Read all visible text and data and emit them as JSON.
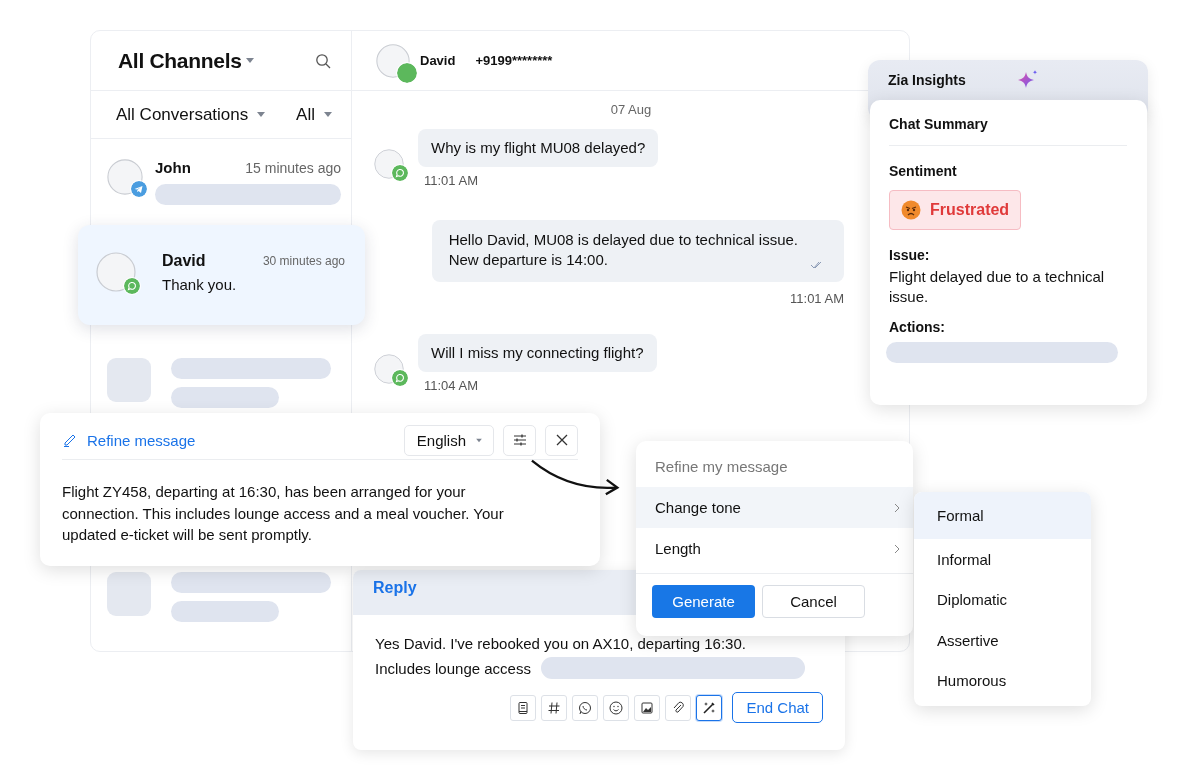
{
  "sidebar": {
    "channel_title": "All Channels",
    "filter": "All Conversations",
    "status_filter": "All",
    "conversations": [
      {
        "name": "John",
        "time": "15 minutes ago",
        "kind": "telegram",
        "selected": false
      },
      {
        "name": "David",
        "time": "30 minutes ago",
        "preview": "Thank you.",
        "kind": "whatsapp",
        "selected": true
      }
    ]
  },
  "chat": {
    "contact": "David",
    "phone": "+9199********",
    "date": "07 Aug",
    "messages": [
      {
        "kind": "incoming",
        "text": "Why is my flight MU08 delayed?",
        "time": "11:01 AM"
      },
      {
        "kind": "outgoing",
        "text": "Hello David, MU08 is delayed due to technical issue.\nNew departure is 14:00.",
        "time": "11:01 AM",
        "read": true
      },
      {
        "kind": "incoming",
        "text": "Will I miss my connecting flight?",
        "time": "11:04 AM"
      }
    ]
  },
  "insights": {
    "title": "Zia Insights",
    "section": "Chat Summary",
    "sentiment_label": "Sentiment",
    "sentiment": "Frustrated",
    "issue_label": "Issue:",
    "issue": "Flight delayed due to a technical issue.",
    "actions_label": "Actions:"
  },
  "refine": {
    "title": "Refine message",
    "language": "English",
    "text": "Flight ZY458, departing at 16:30, has been arranged for your connection. This includes lounge access and a meal voucher. Your updated e-ticket will be sent promptly."
  },
  "refine_menu": {
    "title": "Refine my message",
    "items": [
      {
        "label": "Change tone",
        "selected": true
      },
      {
        "label": "Length",
        "selected": false
      }
    ],
    "buttons": [
      {
        "label": "Generate",
        "kind": "primary"
      },
      {
        "label": "Cancel",
        "kind": "secondary"
      }
    ]
  },
  "tone_menu": [
    {
      "label": "Formal",
      "selected": true
    },
    {
      "label": "Informal",
      "selected": false
    },
    {
      "label": "Diplomatic",
      "selected": false
    },
    {
      "label": "Assertive",
      "selected": false
    },
    {
      "label": "Humorous",
      "selected": false
    }
  ],
  "reply": {
    "tab": "Reply",
    "lines": [
      "Yes David. I've rebooked you on AX10, departing 16:30.",
      "Includes lounge access"
    ],
    "tools": [
      {
        "kind": "article",
        "selected": false
      },
      {
        "kind": "hash",
        "selected": false
      },
      {
        "kind": "whatsapp",
        "selected": false
      },
      {
        "kind": "emoji",
        "selected": false
      },
      {
        "kind": "image",
        "selected": false
      },
      {
        "kind": "attach",
        "selected": false
      },
      {
        "kind": "magic",
        "selected": true
      }
    ],
    "end_button": "End Chat"
  }
}
